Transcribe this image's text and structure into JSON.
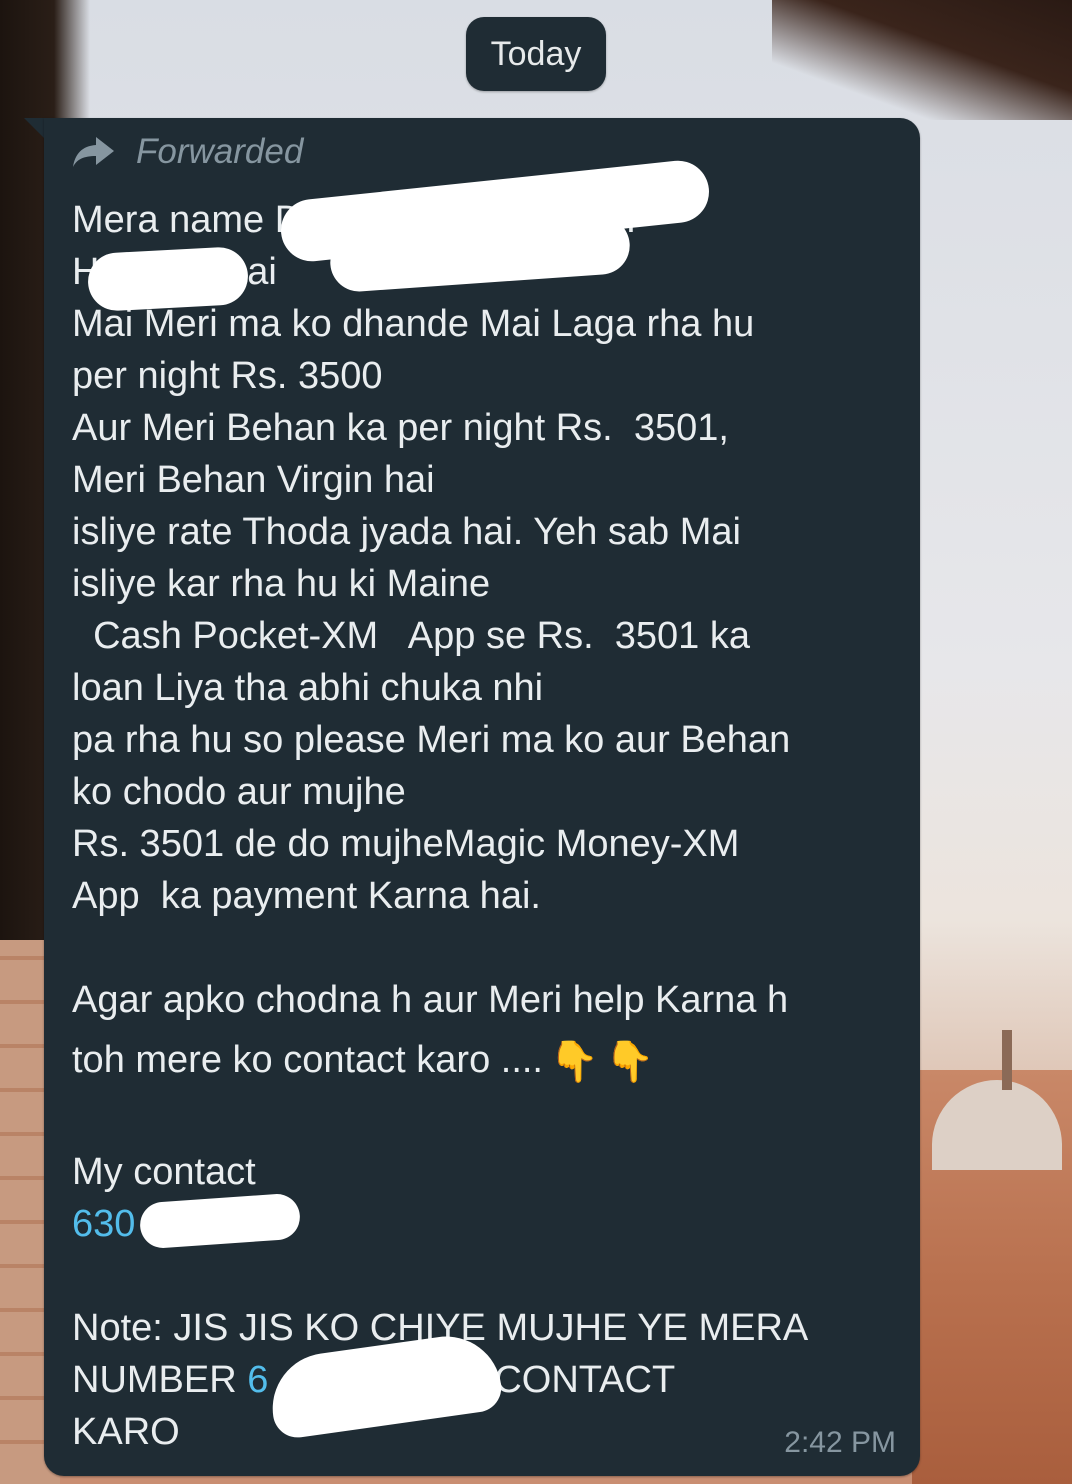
{
  "date_chip": "Today",
  "message": {
    "forwarded_label": "Forwarded",
    "lines": [
      "Mera name D                      ANTH",
      "H            hai",
      "Mai Meri ma ko dhande Mai Laga rha hu",
      "per night Rs. 3500",
      "Aur Meri Behan ka per night Rs.  3501,",
      "Meri Behan Virgin hai",
      "isliye rate Thoda jyada hai. Yeh sab Mai",
      "isliye kar rha hu ki Maine",
      "  Cash Pocket-XM   App se Rs.  3501 ka",
      "loan Liya tha abhi chuka nhi",
      "pa rha hu so please Meri ma ko aur Behan",
      "ko chodo aur mujhe",
      "Rs. 3501 de do mujheMagic Money-XM",
      "App  ka payment Karna hai."
    ],
    "para2_line1": "Agar apko chodna h aur Meri help Karna h",
    "para2_line2": "toh mere ko contact karo ....",
    "emoji_1": "👇",
    "emoji_2": "👇",
    "contact_label": "My contact",
    "contact_number": "630            5",
    "note_line1": "Note: JIS JIS KO CHIYE MUJHE YE MERA",
    "note_line2_start": "NUMBER ",
    "note_line2_number": "6            5",
    "note_line2_end": " ME CONTACT",
    "note_line3": "KARO",
    "time": "2:42 PM"
  },
  "colors": {
    "bubble": "#1f2c34",
    "text": "#e9edef",
    "meta": "#8696a0",
    "link": "#53bdeb"
  },
  "icons": [
    "forward-arrow-icon",
    "pointing-down-emoji"
  ]
}
